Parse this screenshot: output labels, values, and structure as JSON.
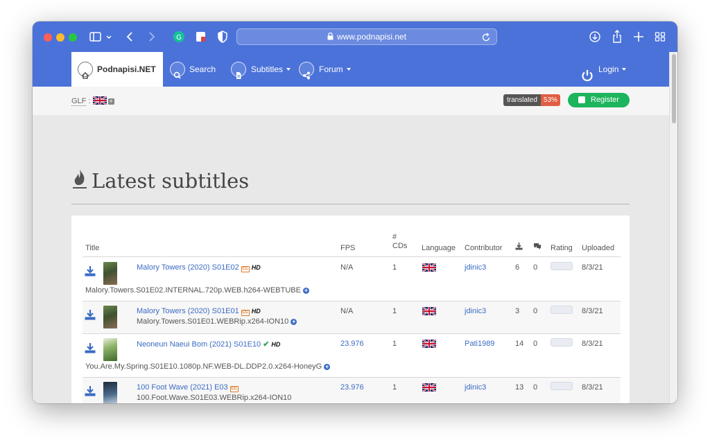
{
  "browser": {
    "url": "www.podnapisi.net"
  },
  "nav": {
    "brand": "Podnapisi.NET",
    "search": "Search",
    "subtitles": "Subtitles",
    "forum": "Forum",
    "login": "Login"
  },
  "subbar": {
    "glf_label": "GLF",
    "glf_colon": ":",
    "translated_label": "translated",
    "translated_pct": "53%",
    "register": "Register"
  },
  "page": {
    "heading": "Latest subtitles"
  },
  "table": {
    "headers": {
      "title": "Title",
      "fps": "FPS",
      "cds_hash": "#",
      "cds": "CDs",
      "language": "Language",
      "contributor": "Contributor",
      "rating": "Rating",
      "uploaded": "Uploaded"
    },
    "rows": [
      {
        "title": "Malory Towers (2020) S01E02",
        "release": "Malory.Towers.S01E02.INTERNAL.720p.WEB.h264-WEBTUBE",
        "fps": "N/A",
        "cds": "1",
        "contributor": "jdinic3",
        "downloads": "6",
        "comments": "0",
        "uploaded": "8/3/21",
        "cc": "CC",
        "hd": "HD"
      },
      {
        "title": "Malory Towers (2020) S01E01",
        "release": "Malory.Towers.S01E01.WEBRip.x264-ION10",
        "fps": "N/A",
        "cds": "1",
        "contributor": "jdinic3",
        "downloads": "3",
        "comments": "0",
        "uploaded": "8/3/21",
        "cc": "CC",
        "hd": "HD"
      },
      {
        "title": "Neoneun Naeui Bom (2021) S01E10",
        "release": "You.Are.My.Spring.S01E10.1080p.NF.WEB-DL.DDP2.0.x264-HoneyG",
        "fps": "23.976",
        "cds": "1",
        "contributor": "Pati1989",
        "downloads": "14",
        "comments": "0",
        "uploaded": "8/3/21",
        "check": "✔",
        "hd": "HD"
      },
      {
        "title": "100 Foot Wave (2021) E03",
        "release": "100.Foot.Wave.S01E03.WEBRip.x264-ION10",
        "fps": "23.976",
        "cds": "1",
        "contributor": "jdinic3",
        "downloads": "13",
        "comments": "0",
        "uploaded": "8/3/21",
        "cc": "CC"
      }
    ]
  },
  "colors": {
    "toolbar": "#4b72d9",
    "link": "#3a6bc4",
    "register": "#1cb45c",
    "badge_red": "#e05d44"
  },
  "icons": [
    "sidebar-icon",
    "back-icon",
    "forward-icon",
    "grammarly-icon",
    "extension-icon",
    "shield-icon",
    "lock-icon",
    "reload-icon",
    "downloads-icon",
    "share-icon",
    "new-tab-icon",
    "tab-overview-icon",
    "home-icon",
    "search-icon",
    "document-icon",
    "share-nodes-icon",
    "power-icon",
    "fire-icon",
    "download-icon",
    "comments-icon",
    "uk-flag-icon"
  ]
}
